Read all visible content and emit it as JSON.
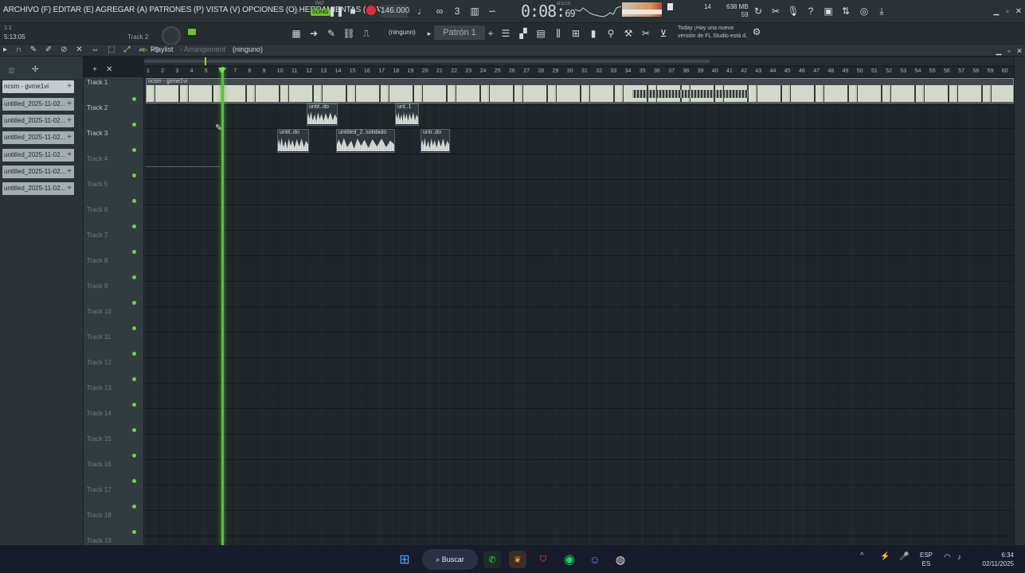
{
  "menu": "ARCHIVO (F) EDITAR (E) AGREGAR (A) PATRONES (P) VISTA (V) OPCIONES (O) HERRAMIENTAS (T) AYUDA",
  "transport": {
    "mode_small": "PAT",
    "mode_badge": "SONG",
    "tempo": "146.000",
    "time_main": "0:08",
    "time_frac": "69",
    "time_sub": "M:S:CS"
  },
  "monitor": {
    "polyphony": "14",
    "mem_top": "638 MB",
    "mem_bottom": "59"
  },
  "toolbar2": {
    "pos_hint": "1:1",
    "pos_value": "5:13:05",
    "track_hint": "Track 2",
    "snap_value": "(ninguno)",
    "pattern": "Patrón 1",
    "news_line1": "Today ¡Hay una nueva",
    "news_line2": "versión de FL Studio está d."
  },
  "playlist": {
    "title": "Playlist",
    "subtitle": "- Arrangement",
    "selected": "(ninguno)",
    "tools_glyphs": "▸ ∩  ✎ ✐ ⊘ ✕ ⇔ ⬚ ⤢ ⌕ ◁"
  },
  "clip_sources": [
    "ncsm - gvme1vi",
    "untitled_2025-11-02...",
    "untitled_2025-11-02...",
    "untitled_2025-11-02...",
    "untitled_2025-11-02...",
    "untitled_2025-11-02...",
    "untitled_2025-11-02..."
  ],
  "tracks": [
    "Track 1",
    "Track 2",
    "Track 3",
    "Track 4",
    "Track 5",
    "Track 6",
    "Track 7",
    "Track 8",
    "Track 9",
    "Track 10",
    "Track 11",
    "Track 12",
    "Track 13",
    "Track 14",
    "Track 15",
    "Track 16",
    "Track 17",
    "Track 18",
    "Track 19"
  ],
  "ruler": [
    "1",
    "2",
    "3",
    "4",
    "5",
    "6",
    "7",
    "8",
    "9",
    "10",
    "11",
    "12",
    "13",
    "14",
    "15",
    "16",
    "17",
    "18",
    "19",
    "20",
    "21",
    "22",
    "23",
    "24",
    "25",
    "26",
    "27",
    "28",
    "29",
    "30",
    "31",
    "32",
    "33",
    "34",
    "35",
    "36",
    "37",
    "38",
    "39",
    "40",
    "41",
    "42",
    "43",
    "44",
    "45",
    "46",
    "47",
    "48",
    "49",
    "50",
    "51",
    "52",
    "53",
    "54",
    "55",
    "56",
    "57",
    "58",
    "59",
    "60"
  ],
  "clips": {
    "main": "ncsm - gvme1vi",
    "t2a": "untit..do",
    "t2b": "unt..1",
    "t3a": "untit..do",
    "t3b": "untitled_2..solidado",
    "t3c": "unti..do"
  },
  "taskbar": {
    "search": "Buscar",
    "lang1": "ESP",
    "lang2": "ES",
    "time": "6:34",
    "date": "02/11/2025",
    "tray": "^"
  },
  "colors": {
    "playhead": "#57c23a",
    "record": "#d6303a",
    "song_badge": "#6fbf2e",
    "track_dot": "#6fd34a"
  }
}
